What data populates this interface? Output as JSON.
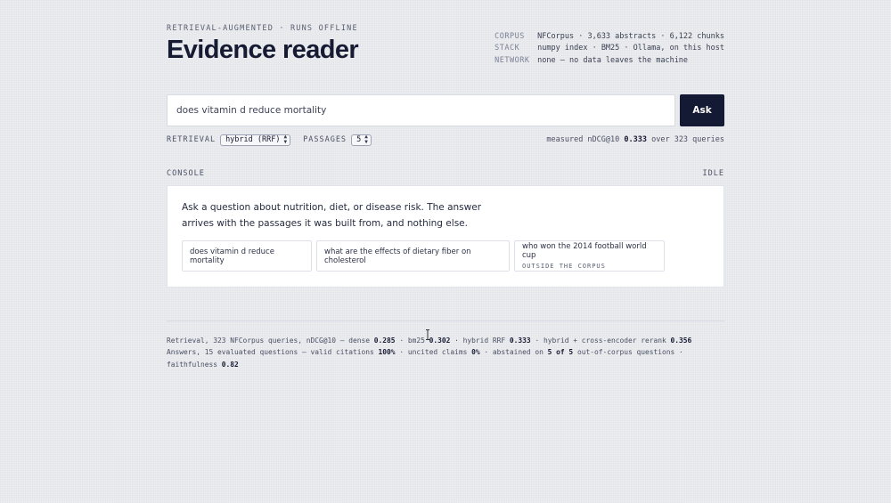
{
  "header": {
    "eyebrow": "RETRIEVAL-AUGMENTED · RUNS OFFLINE",
    "title": "Evidence reader"
  },
  "meta": [
    {
      "key": "CORPUS",
      "value": "NFCorpus · 3,633 abstracts · 6,122 chunks"
    },
    {
      "key": "STACK",
      "value": "numpy index · BM25 · Ollama, on this host"
    },
    {
      "key": "NETWORK",
      "value": "none — no data leaves the machine"
    }
  ],
  "search": {
    "value": "does vitamin d reduce mortality",
    "button_label": "Ask"
  },
  "controls": {
    "retrieval_label": "RETRIEVAL",
    "retrieval_value": "hybrid (RRF)",
    "passages_label": "PASSAGES",
    "passages_value": "5",
    "measured_prefix": "measured nDCG@10",
    "measured_score": "0.333",
    "measured_suffix": "over 323 queries"
  },
  "console": {
    "label": "CONSOLE",
    "status": "IDLE",
    "intro": "Ask a question about nutrition, diet, or disease risk. The answer arrives with the passages it was built from, and nothing else.",
    "examples": [
      {
        "text": "does vitamin d reduce mortality"
      },
      {
        "text": "what are the effects of dietary fiber on cholesterol"
      },
      {
        "text": "who won the 2014 football world cup",
        "note": "OUTSIDE THE CORPUS"
      }
    ]
  },
  "footer": {
    "retrieval": {
      "intro": "Retrieval, 323 NFCorpus queries, nDCG@10 — dense",
      "dense": "0.285",
      "bm25_label": "· bm25",
      "bm25": "0.302",
      "hybrid_label": "· hybrid RRF",
      "hybrid": "0.333",
      "rerank_label": "· hybrid + cross-encoder rerank",
      "rerank": "0.356"
    },
    "answers": {
      "intro": "Answers, 15 evaluated questions — valid citations",
      "citations": "100%",
      "uncited_label": "· uncited claims",
      "uncited": "0%",
      "abstained_label": "· abstained on",
      "abstained": "5 of 5",
      "ooc_label": "out-of-corpus questions · faithfulness",
      "faithfulness": "0.82"
    }
  }
}
